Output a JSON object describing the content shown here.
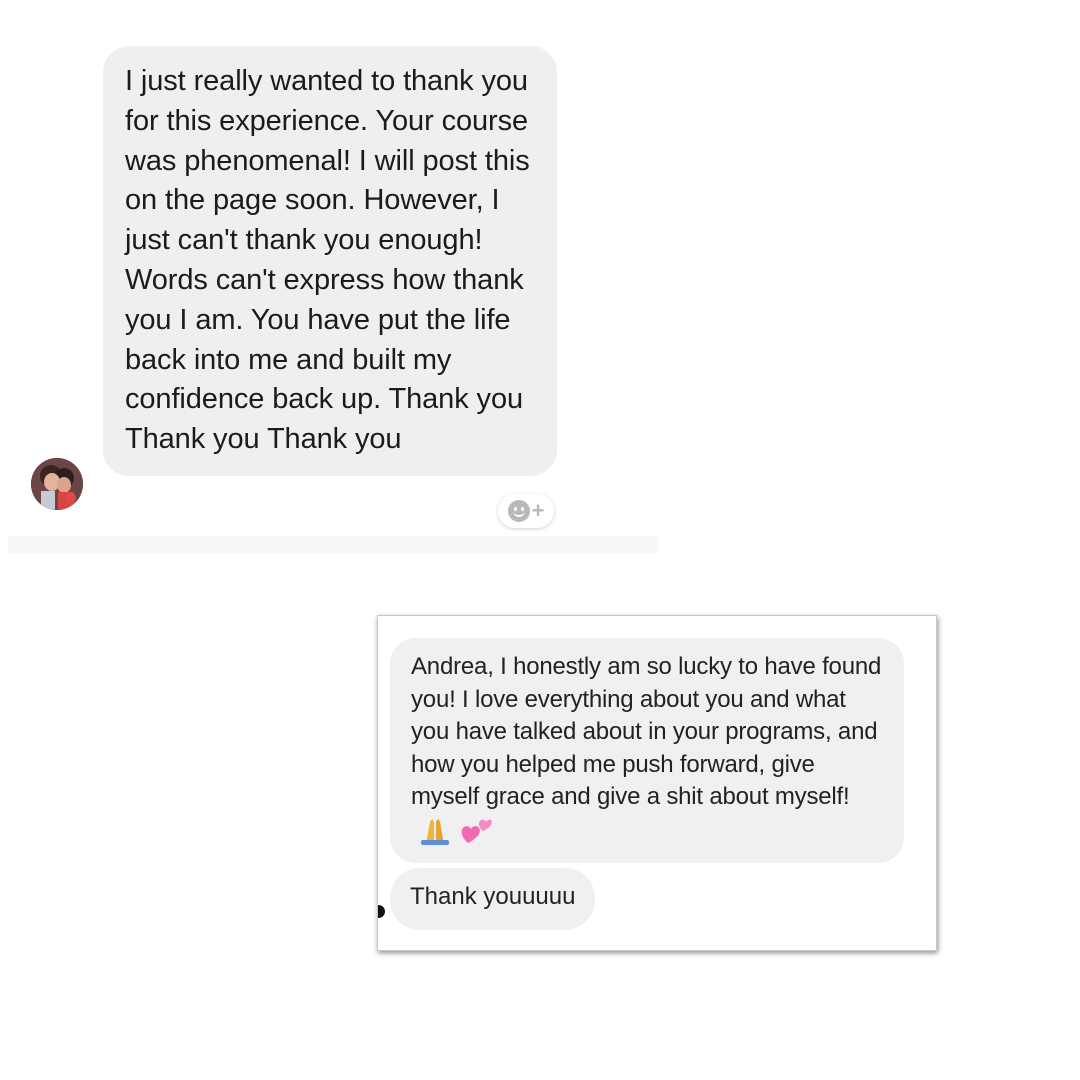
{
  "first_chat": {
    "avatar_icon": "profile-photo-avatar",
    "message": "I just really wanted to thank you for this experience. Your course was phenomenal! I will post this on the page soon. However, I just can't thank you enough! Words can't express how thank you I am. You have put the life back into me and built my confidence back up. Thank you Thank you Thank you",
    "reaction_button_icon": "add-reaction-icon",
    "reaction_plus": "+"
  },
  "second_chat": {
    "message_text": "Andrea, I honestly am so lucky to have found you! I love everything about you and what you have talked about in your programs, and how you helped me push forward, give myself grace and give a shit about myself!",
    "emoji_icons": [
      "folded-hands-icon",
      "two-hearts-icon"
    ],
    "followup_message": "Thank youuuuu"
  },
  "colors": {
    "bubble": "#efefef",
    "text": "#1b1b1b",
    "heart": "#f06ab0",
    "hands": "#f0b43a"
  }
}
